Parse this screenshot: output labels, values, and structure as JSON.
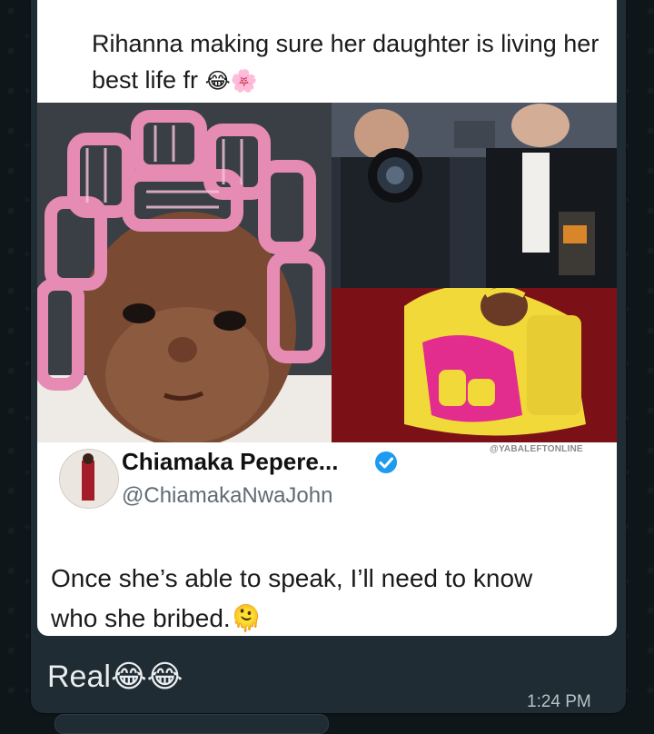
{
  "post": {
    "caption_text": "Rihanna making sure her daughter is living her best life fr",
    "caption_emojis": "😂🌸",
    "watermark": "@YABALEFTONLINE",
    "author_name": "Chiamaka Pepere...",
    "author_handle": "@ChiamakaNwaJohn",
    "tweet_text": "Once she’s able to speak, I’ll need to know who she bribed.",
    "tweet_emoji": "🫠"
  },
  "message": {
    "text": "Real",
    "emojis": "😂😂",
    "time": "1:24 PM"
  },
  "colors": {
    "chat_bg": "#0e1619",
    "bubble_bg": "#1f2c33",
    "verified_blue": "#1d9bf0"
  }
}
